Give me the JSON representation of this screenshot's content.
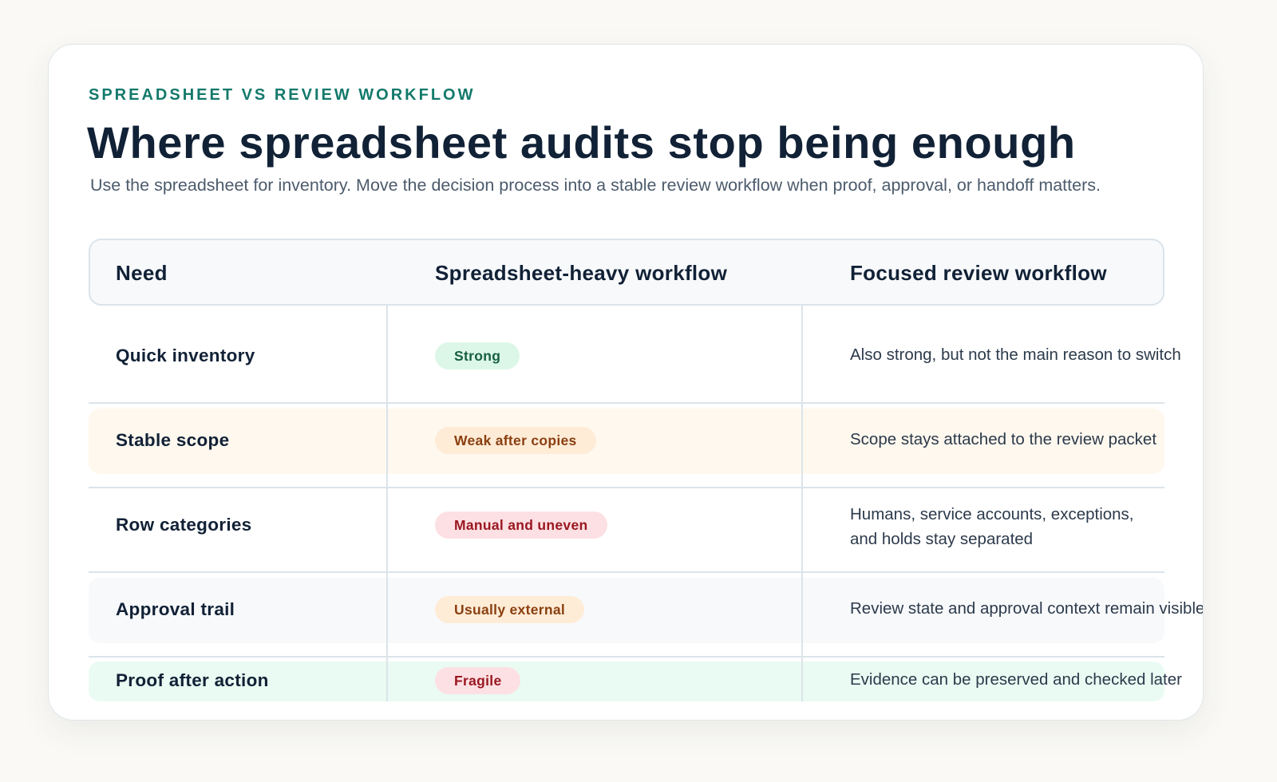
{
  "eyebrow": "SPREADSHEET VS REVIEW WORKFLOW",
  "title": "Where spreadsheet audits stop being enough",
  "subtitle": "Use the spreadsheet for inventory. Move the decision process into a stable review workflow when proof, approval, or handoff matters.",
  "columns": [
    "Need",
    "Spreadsheet-heavy workflow",
    "Focused review workflow"
  ],
  "rows": [
    {
      "need": "Quick inventory",
      "spreadsheet": "Strong",
      "focused": "Also strong, but not the main reason to switch",
      "focused_2": ""
    },
    {
      "need": "Stable scope",
      "spreadsheet": "Weak after copies",
      "focused": "Scope stays attached to the review packet",
      "focused_2": ""
    },
    {
      "need": "Row categories",
      "spreadsheet": "Manual and uneven",
      "focused": "Humans, service accounts, exceptions,",
      "focused_2": "and holds stay separated"
    },
    {
      "need": "Approval trail",
      "spreadsheet": "Usually external",
      "focused": "Review state and approval context remain visible",
      "focused_2": ""
    },
    {
      "need": "Proof after action",
      "spreadsheet": "Fragile",
      "focused": "Evidence can be preserved and checked later",
      "focused_2": ""
    }
  ],
  "colors": {
    "accent": "#13796b",
    "title": "#112136",
    "strong_bg": "#dcf7e8",
    "strong_text": "#17603f",
    "warn_bg": "#feecd7",
    "warn_text": "#8a3f10",
    "bad_bg": "#fde0e3",
    "bad_text": "#99161f",
    "row_warm": "#fef8ee",
    "row_cool": "#f7f9fb",
    "row_mint": "#eafbf3"
  }
}
